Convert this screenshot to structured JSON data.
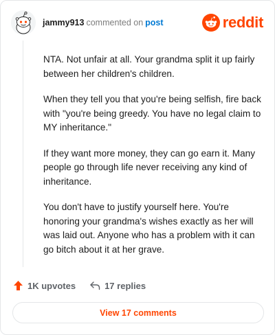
{
  "header": {
    "username": "jammy913",
    "action_text": "commented on",
    "post_link": "post",
    "brand_name": "reddit",
    "avatar_icon": "reddit-snoo-avatar-icon",
    "brand_icon": "reddit-logo-icon"
  },
  "comment": {
    "paragraphs": [
      "NTA. Not unfair at all. Your grandma split it up fairly between her children's children.",
      "When they tell you that you're being selfish, fire back with \"you're being greedy. You have no legal claim to MY inheritance.\"",
      "If they want more money, they can go earn it. Many people go through life never receiving any kind of inheritance.",
      "You don't have to justify yourself here. You're honoring your grandma's wishes exactly as her will was laid out. Anyone who has a problem with it can go bitch about it at her grave."
    ]
  },
  "actions": {
    "upvotes_label": "1K upvotes",
    "replies_label": "17 replies",
    "upvote_icon": "upvote-arrow-icon",
    "reply_icon": "reply-arrow-icon"
  },
  "footer": {
    "view_comments_label": "View 17 comments"
  },
  "colors": {
    "brand": "#ff4500",
    "link": "#0079d3",
    "muted": "#7c7c7c",
    "border": "#e4e6e8"
  }
}
